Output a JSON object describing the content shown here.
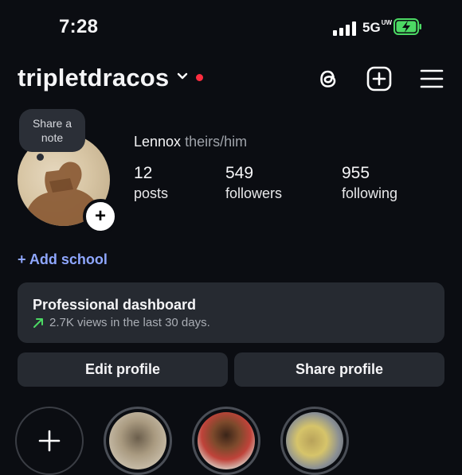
{
  "status_bar": {
    "time": "7:28",
    "network": "5G",
    "network_sup": "UW"
  },
  "header": {
    "username": "tripletdracos",
    "icons": [
      "threads-icon",
      "create-post-icon",
      "menu-icon"
    ]
  },
  "note": {
    "text": "Share a note"
  },
  "profile": {
    "name": "Lennox",
    "pronouns": "theirs/him",
    "stats": [
      {
        "value": "12",
        "label": "posts"
      },
      {
        "value": "549",
        "label": "followers"
      },
      {
        "value": "955",
        "label": "following"
      }
    ]
  },
  "add_school": "+ Add school",
  "dashboard": {
    "title": "Professional dashboard",
    "subtitle": "2.7K views in the last 30 days."
  },
  "buttons": {
    "edit": "Edit profile",
    "share": "Share profile"
  },
  "colors": {
    "background": "#0b0d12",
    "accent": "#8fa7ff",
    "battery": "#4cd964",
    "trend": "#4cd964",
    "notification_dot": "#ff2d3f"
  }
}
